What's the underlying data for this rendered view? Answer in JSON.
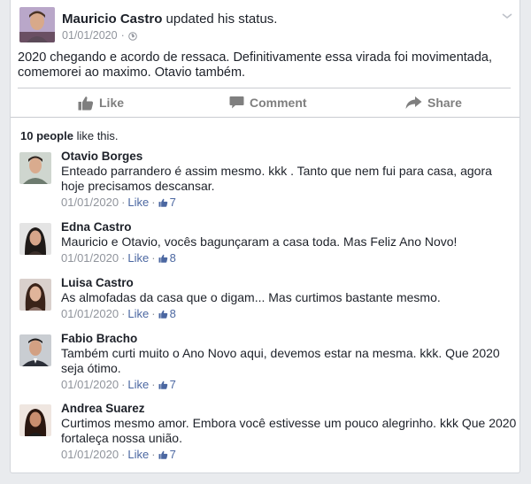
{
  "post": {
    "author": "Mauricio Castro",
    "action": "updated his status.",
    "date": "01/01/2020",
    "separator": "·",
    "text": "2020 chegando e acordo de ressaca. Definitivamente essa virada foi movimentada, comemorei ao maximo. Otavio também.",
    "icons": {
      "privacy": "globe-icon",
      "menu": "chevron-down-icon"
    }
  },
  "actions": {
    "like": "Like",
    "comment": "Comment",
    "share": "Share"
  },
  "likes": {
    "count_label": "10 people",
    "suffix": " like this."
  },
  "comments": [
    {
      "name": "Otavio Borges",
      "text": "Enteado parrandero é assim mesmo. kkk . Tanto que nem fui para casa, agora hoje precisamos descansar.",
      "date": "01/01/2020",
      "like": "Like",
      "likes": "7"
    },
    {
      "name": "Edna Castro",
      "text": "Mauricio e Otavio, vocês bagunçaram a casa toda. Mas Feliz Ano Novo!",
      "date": "01/01/2020",
      "like": "Like",
      "likes": "8"
    },
    {
      "name": "Luisa Castro",
      "text": "As almofadas da casa que o digam... Mas curtimos bastante mesmo.",
      "date": "01/01/2020",
      "like": "Like",
      "likes": "8"
    },
    {
      "name": "Fabio Bracho",
      "text": "Também curti muito o Ano Novo aqui, devemos estar na mesma. kkk. Que 2020 seja ótimo.",
      "date": "01/01/2020",
      "like": "Like",
      "likes": "7"
    },
    {
      "name": "Andrea Suarez",
      "text": "Curtimos mesmo amor. Embora você estivesse um pouco alegrinho. kkk Que 2020 fortaleça nossa união.",
      "date": "01/01/2020",
      "like": "Like",
      "likes": "7"
    }
  ],
  "colors": {
    "link_blue": "#4b67a1",
    "meta_gray": "#90949c",
    "action_gray": "#7f7f7f"
  }
}
